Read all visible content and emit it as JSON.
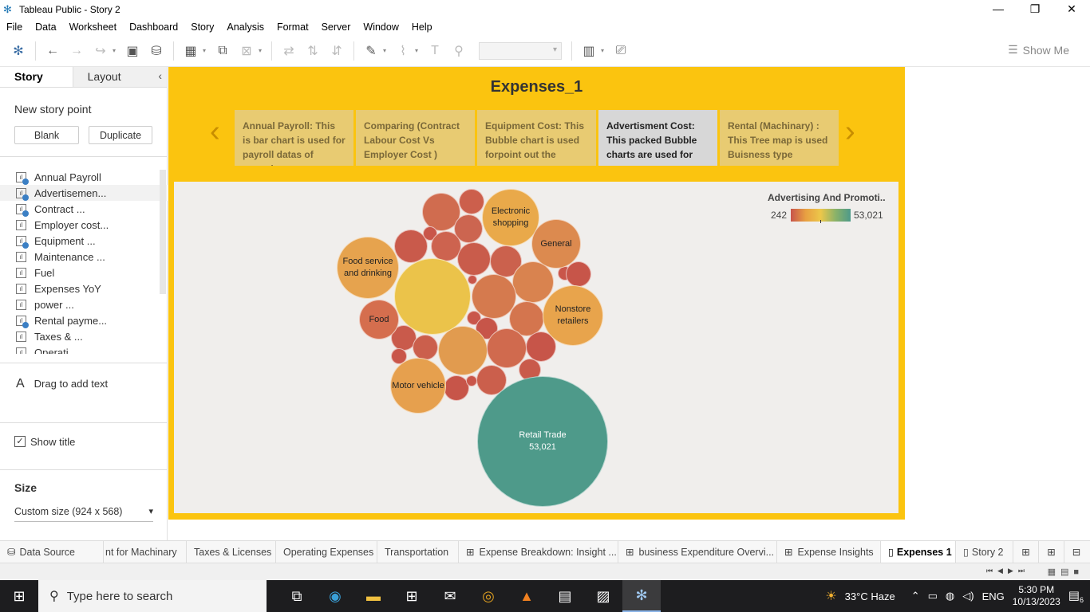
{
  "window": {
    "title": "Tableau Public - Story 2"
  },
  "menu": [
    "File",
    "Data",
    "Worksheet",
    "Dashboard",
    "Story",
    "Analysis",
    "Format",
    "Server",
    "Window",
    "Help"
  ],
  "toolbar": {
    "show_me": "Show Me"
  },
  "left_panel": {
    "tab_story": "Story",
    "tab_layout": "Layout",
    "new_story_point": "New story point",
    "blank_button": "Blank",
    "duplicate_button": "Duplicate",
    "items": [
      "Annual Payroll",
      "Advertisemen...",
      "Contract ...",
      "Employer cost...",
      "Equipment ...",
      "Maintenance ...",
      "Fuel",
      "Expenses YoY",
      "power ...",
      "Rental payme...",
      "Taxes & ...",
      "Operati..."
    ],
    "drag_text": "Drag to add text",
    "show_title": "Show title",
    "size_label": "Size",
    "size_value": "Custom size (924 x 568)"
  },
  "story": {
    "title": "Expenses_1",
    "points": [
      "Annual Payroll:  This is bar chart is used for payroll datas of annual",
      "Comparing (Contract Labour Cost  Vs Employer Cost )",
      "Equipment Cost:  This Bubble chart is used forpoint out the",
      "Advertisment Cost: This packed Bubble charts are used for",
      "Rental  (Machinary) : This  Tree map is used Buisness type"
    ]
  },
  "legend": {
    "title": "Advertising And Promoti..",
    "min": "242",
    "max": "53,021"
  },
  "bubbles": {
    "electronic": "Electronic shopping",
    "general": "General",
    "food_service": "Food service and drinking",
    "nonstore": "Nonstore retailers",
    "food": "Food",
    "motor": "Motor vehicle",
    "retail": "Retail Trade",
    "retail_value": "53,021"
  },
  "colors": {
    "story_bg": "#fbc40f",
    "retail_bubble": "#4e9a8a",
    "highlight_bubble": "#ebc34a"
  },
  "sheet_tabs": [
    "Data Source",
    "nt for Machinary",
    "Taxes & Licenses",
    "Operating Expenses",
    "Transportation",
    "Expense Breakdown: Insight ...",
    "business Expenditure Overvi...",
    "Expense Insights",
    "Expenses 1",
    "Story 2"
  ],
  "taskbar": {
    "search_placeholder": "Type here to search",
    "weather": "33°C  Haze",
    "lang": "ENG",
    "time": "5:30 PM",
    "date": "10/13/2023",
    "notif_count": "6"
  }
}
